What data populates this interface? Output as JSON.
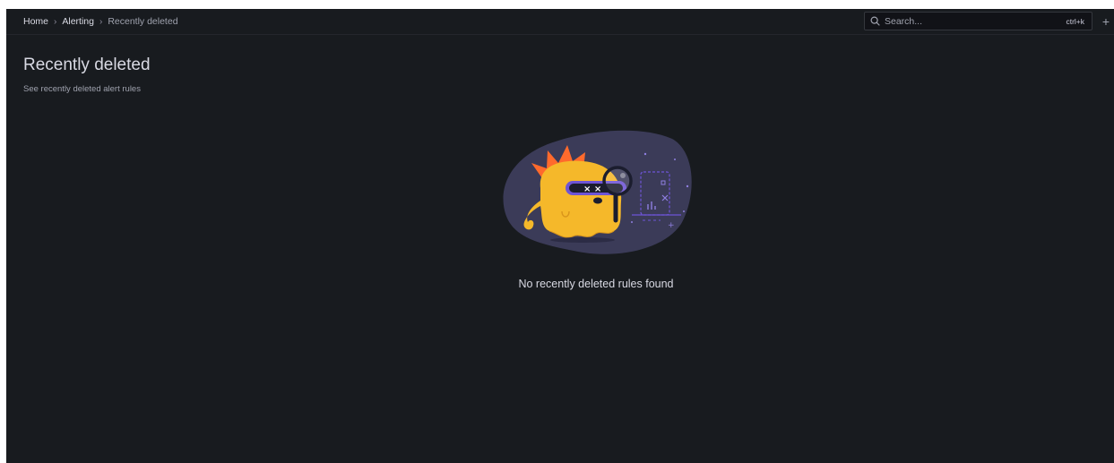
{
  "breadcrumb": {
    "items": [
      "Home",
      "Alerting"
    ],
    "current": "Recently deleted",
    "separator": "›"
  },
  "search": {
    "placeholder": "Search...",
    "shortcut": "ctrl+k",
    "icon": "search-icon"
  },
  "toolbar": {
    "add_label": "+",
    "add_icon": "plus-icon"
  },
  "page": {
    "title": "Recently deleted",
    "subtitle": "See recently deleted alert rules"
  },
  "empty_state": {
    "illustration": "grot-mascot-magnifier",
    "message": "No recently deleted rules found"
  },
  "colors": {
    "background": "#181b1f",
    "mascot_orange": "#f5b82a",
    "accent_purple": "#6e54d6",
    "blob": "#3b3b58"
  }
}
